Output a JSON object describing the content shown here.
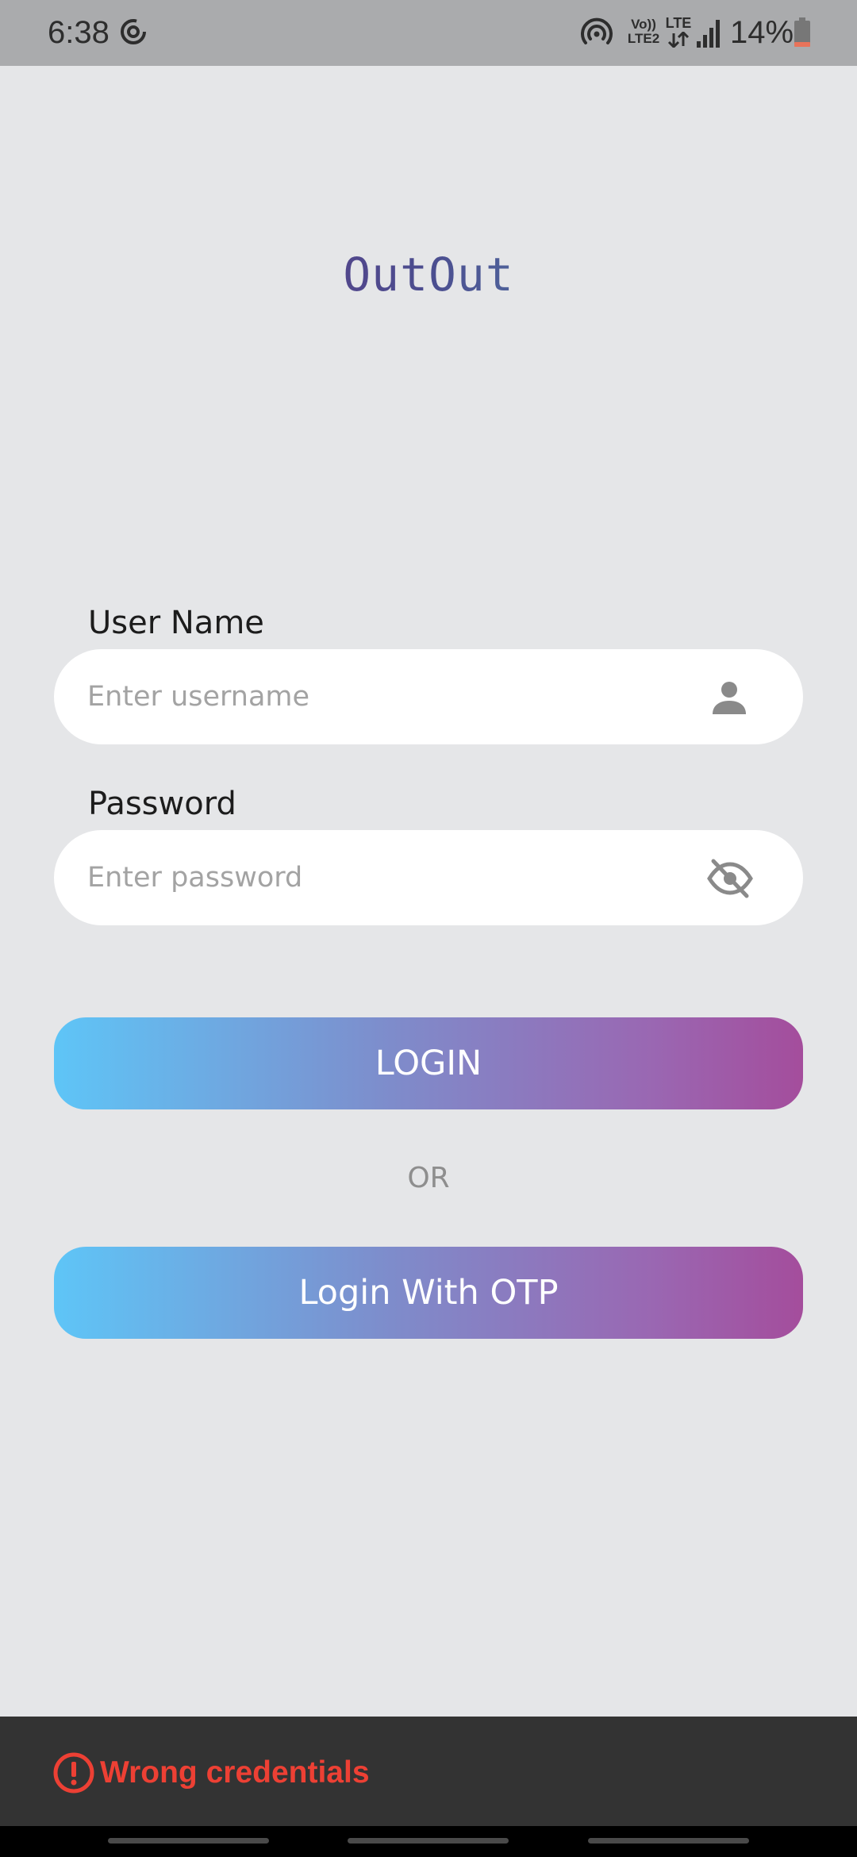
{
  "status_bar": {
    "time": "6:38",
    "volte_line1": "Vo))",
    "volte_line2": "LTE2",
    "lte": "LTE",
    "battery": "14%",
    "icons": [
      "sync-icon",
      "hotspot-icon",
      "lte-arrows-icon",
      "signal-icon",
      "battery-icon"
    ]
  },
  "app": {
    "logo": "OutOut"
  },
  "form": {
    "username_label": "User Name",
    "username_placeholder": "Enter username",
    "username_value": "",
    "username_icon": "person-icon",
    "password_label": "Password",
    "password_placeholder": "Enter password",
    "password_value": "",
    "password_icon": "eye-off-icon"
  },
  "actions": {
    "login_label": "LOGIN",
    "or_label": "OR",
    "otp_login_label": "Login With OTP",
    "gradient_start": "#5ec5f7",
    "gradient_end": "#a44d9c"
  },
  "snackbar": {
    "icon": "error-icon",
    "message": "Wrong credentials",
    "color": "#ed4034"
  }
}
